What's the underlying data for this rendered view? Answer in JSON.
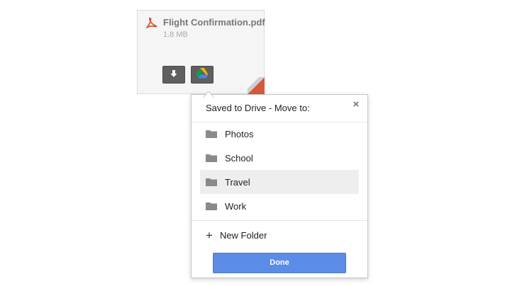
{
  "attachment": {
    "file_name": "Flight Confirmation.pdf",
    "file_size": "1.8 MB",
    "icon": "pdf-icon",
    "pdf_color": "#d9583a",
    "buttons": {
      "download_icon": "download-icon",
      "drive_icon": "google-drive-icon"
    }
  },
  "popup": {
    "title": "Saved to Drive - Move to:",
    "close_label": "×",
    "folders": [
      {
        "label": "Photos",
        "selected": false
      },
      {
        "label": "School",
        "selected": false
      },
      {
        "label": "Travel",
        "selected": true
      },
      {
        "label": "Work",
        "selected": false
      }
    ],
    "new_folder_icon": "+",
    "new_folder_label": "New Folder",
    "done_label": "Done"
  },
  "colors": {
    "accent": "#5b8ce8",
    "folder_icon": "#8a8a8a",
    "selected_row": "#eeeeee"
  }
}
